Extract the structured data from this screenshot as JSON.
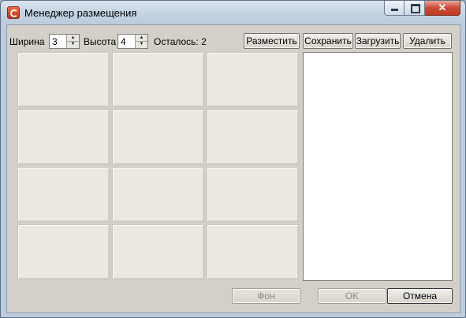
{
  "window": {
    "title": "Менеджер размещения",
    "icon": "app-logo-icon",
    "caption_buttons": {
      "close_glyph": "✕"
    }
  },
  "controls": {
    "width_label": "Ширина",
    "width_value": "3",
    "height_label": "Высота",
    "height_value": "4",
    "remaining_label": "Осталось: 2",
    "place_button": "Разместить",
    "save_button": "Сохранить",
    "load_button": "Загрузить",
    "delete_button": "Удалить"
  },
  "grid": {
    "columns": 3,
    "rows": 4
  },
  "footer": {
    "background_button": "Фон",
    "ok_button": "OK",
    "cancel_button": "Отмена"
  },
  "colors": {
    "cell": "#ece8df",
    "dialog": "#d4d0c8",
    "window_frame": "#bcccde"
  }
}
